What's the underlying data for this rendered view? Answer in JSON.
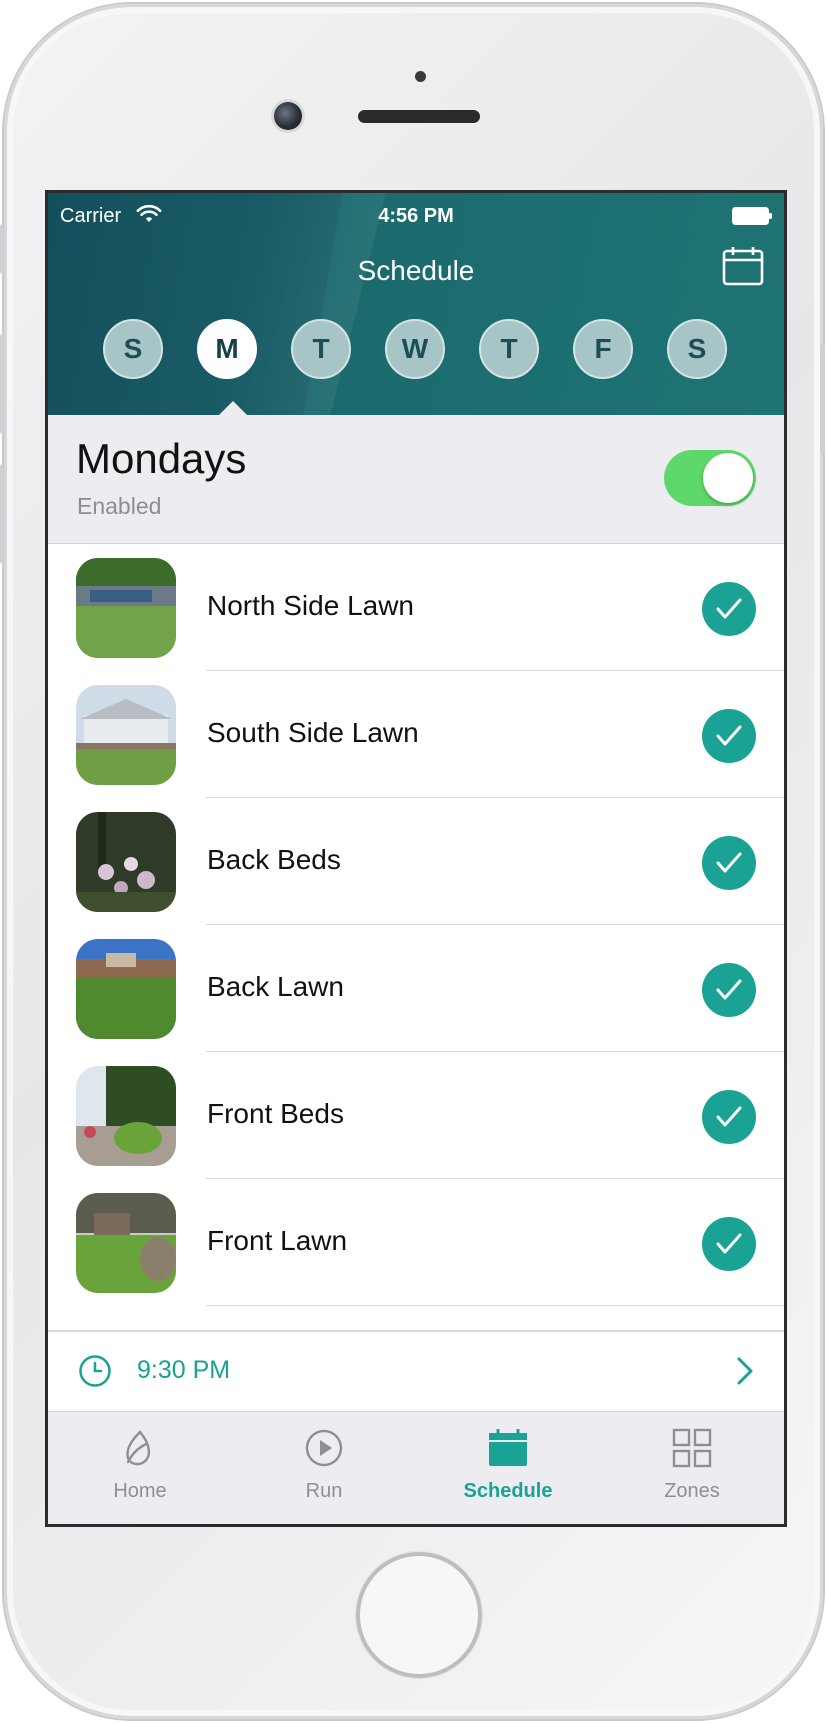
{
  "status_bar": {
    "carrier": "Carrier",
    "time": "4:56 PM"
  },
  "header": {
    "title": "Schedule",
    "calendar_icon": "calendar-icon"
  },
  "days": [
    {
      "letter": "S",
      "selected": false
    },
    {
      "letter": "M",
      "selected": true
    },
    {
      "letter": "T",
      "selected": false
    },
    {
      "letter": "W",
      "selected": false
    },
    {
      "letter": "T",
      "selected": false
    },
    {
      "letter": "F",
      "selected": false
    },
    {
      "letter": "S",
      "selected": false
    }
  ],
  "day_settings": {
    "title": "Mondays",
    "status": "Enabled",
    "enabled": true
  },
  "zones": [
    {
      "name": "North Side Lawn",
      "checked": true
    },
    {
      "name": "South Side Lawn",
      "checked": true
    },
    {
      "name": "Back Beds",
      "checked": true
    },
    {
      "name": "Back Lawn",
      "checked": true
    },
    {
      "name": "Front Beds",
      "checked": true
    },
    {
      "name": "Front Lawn",
      "checked": true
    }
  ],
  "start_time": "9:30 PM",
  "tabs": [
    {
      "label": "Home",
      "icon": "leaf-icon",
      "active": false
    },
    {
      "label": "Run",
      "icon": "play-icon",
      "active": false
    },
    {
      "label": "Schedule",
      "icon": "calendar-icon",
      "active": true
    },
    {
      "label": "Zones",
      "icon": "grid-icon",
      "active": false
    }
  ],
  "colors": {
    "accent": "#1aa294",
    "header": "#1a6068",
    "toggle_on": "#5fd86b"
  }
}
